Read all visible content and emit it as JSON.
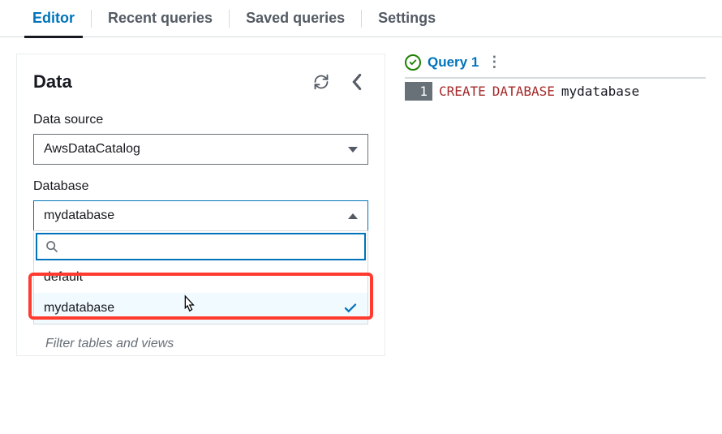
{
  "tabs": {
    "editor": "Editor",
    "recent": "Recent queries",
    "saved": "Saved queries",
    "settings": "Settings"
  },
  "sidebar": {
    "title": "Data",
    "data_source_label": "Data source",
    "data_source_value": "AwsDataCatalog",
    "database_label": "Database",
    "database_value": "mydatabase",
    "search_placeholder": "",
    "options": {
      "default": "default",
      "mydatabase": "mydatabase"
    },
    "filter_placeholder": "Filter tables and views"
  },
  "query": {
    "tab_label": "Query 1",
    "line_number": "1",
    "sql_keyword1": "CREATE",
    "sql_keyword2": "DATABASE",
    "sql_identifier": "mydatabase"
  }
}
